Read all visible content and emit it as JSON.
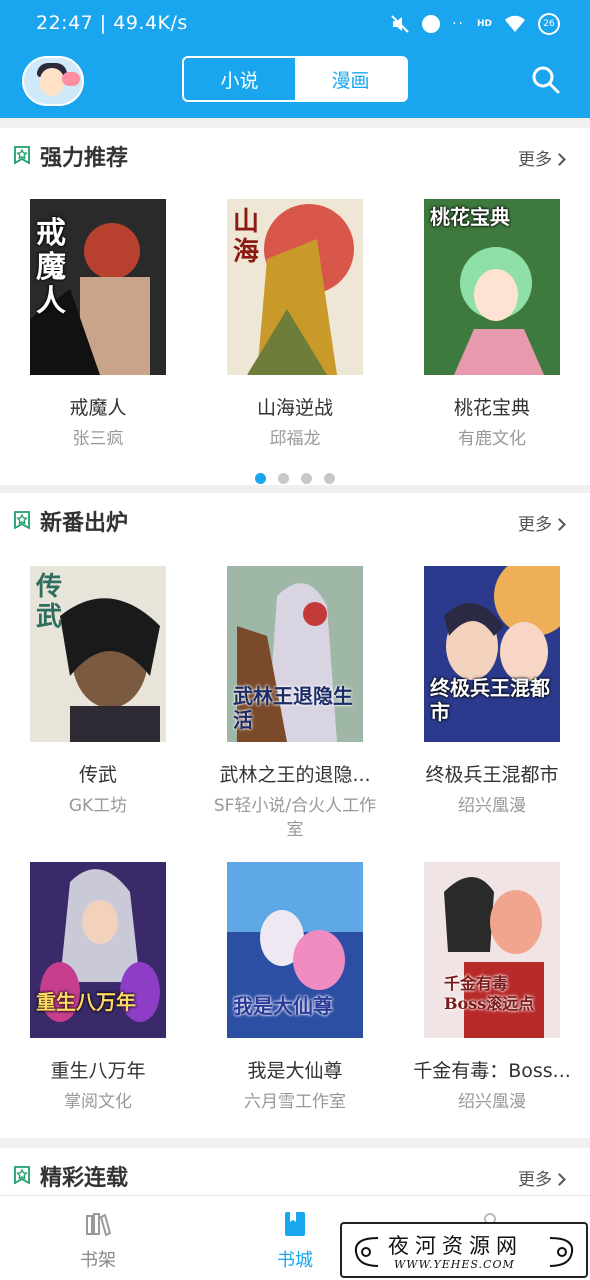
{
  "status_bar": {
    "time": "22:47 | 49.4K/s",
    "dots": "··",
    "network": "HD",
    "battery": "26"
  },
  "header": {
    "tabs": [
      {
        "label": "小说",
        "selected": false
      },
      {
        "label": "漫画",
        "selected": true
      }
    ]
  },
  "sections": [
    {
      "title": "强力推荐",
      "more_label": "更多",
      "items": [
        {
          "title": "戒魔人",
          "author": "张三疯",
          "cover_text": "戒魔人"
        },
        {
          "title": "山海逆战",
          "author": "邱福龙",
          "cover_text": "山海"
        },
        {
          "title": "桃花宝典",
          "author": "有鹿文化",
          "cover_text": "桃花宝典"
        }
      ],
      "pager": {
        "pages": 4,
        "current": 1
      }
    },
    {
      "title": "新番出炉",
      "more_label": "更多",
      "items": [
        {
          "title": "传武",
          "author": "GK工坊",
          "cover_text": "传武"
        },
        {
          "title": "武林之王的退隐...",
          "author": "SF轻小说/合火人工作室",
          "cover_text": "武林王退隐生活"
        },
        {
          "title": "终极兵王混都市",
          "author": "绍兴凰漫",
          "cover_text": "终极兵王混都市"
        },
        {
          "title": "重生八万年",
          "author": "掌阅文化",
          "cover_text": "重生八万年"
        },
        {
          "title": "我是大仙尊",
          "author": "六月雪工作室",
          "cover_text": "我是大仙尊"
        },
        {
          "title": "千金有毒：Boss...",
          "author": "绍兴凰漫",
          "cover_text": "千金有毒 Boss滚远点"
        }
      ]
    },
    {
      "title": "精彩连载",
      "more_label": "更多"
    }
  ],
  "tabbar": {
    "items": [
      {
        "label": "书架",
        "icon": "bookshelf-icon",
        "active": false
      },
      {
        "label": "书城",
        "icon": "bookstore-icon",
        "active": true
      },
      {
        "label": "",
        "icon": "profile-icon",
        "active": false
      }
    ]
  },
  "watermark": {
    "main": "夜河资源网",
    "sub": "WWW.YEHES.COM"
  },
  "colors": {
    "accent": "#1aa5ef",
    "text": "#333333",
    "muted": "#999999"
  }
}
